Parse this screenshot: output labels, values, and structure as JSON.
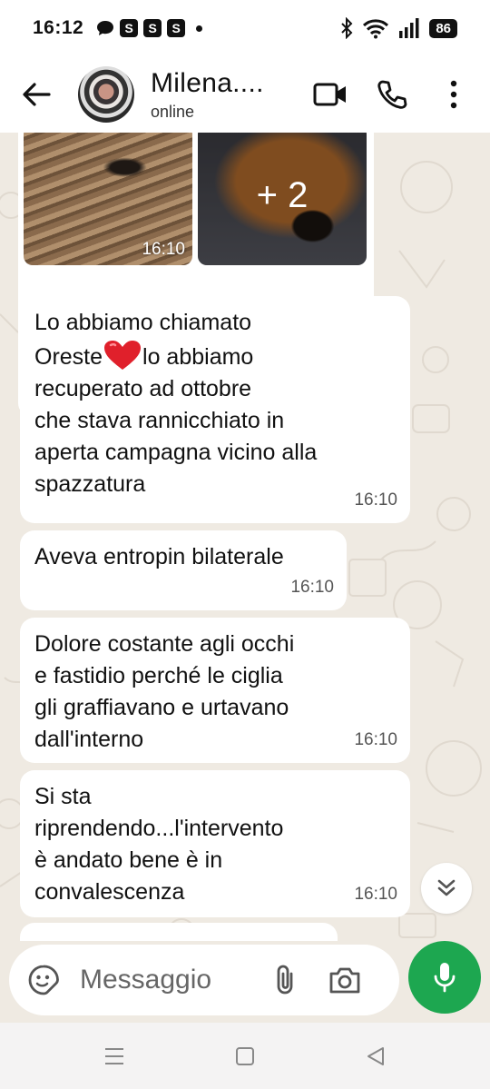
{
  "status_bar": {
    "time": "16:12",
    "notification_badges": [
      "S",
      "S",
      "S"
    ],
    "battery": "86"
  },
  "header": {
    "contact_name": "Milena....",
    "contact_status": "online"
  },
  "media": {
    "more_count": "+ 2",
    "time": "16:10"
  },
  "messages": [
    {
      "text_before": "Lo abbiamo chiamato\nOreste",
      "emoji": "red-heart",
      "text_after": "lo abbiamo\nrecuperato ad ottobre\nche stava rannicchiato in\naperta campagna vicino alla\nspazzatura",
      "time": "16:10"
    },
    {
      "text": "Aveva entropin bilaterale",
      "time": "16:10"
    },
    {
      "text": "Dolore costante agli occhi\ne fastidio perché le ciglia\ngli graffiavano e urtavano\ndall'interno",
      "time": "16:10"
    },
    {
      "text": "Si sta\nriprendendo...l'intervento\nè andato bene è in\nconvalescenza",
      "time": "16:10"
    }
  ],
  "composer": {
    "placeholder": "Messaggio"
  },
  "colors": {
    "accent_green": "#1da750",
    "chat_background": "#efeae2",
    "bubble_incoming": "#ffffff"
  }
}
